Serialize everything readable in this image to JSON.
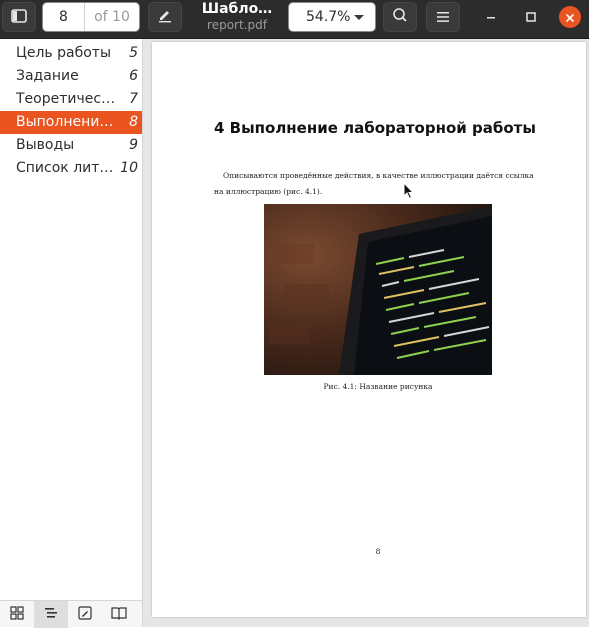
{
  "header": {
    "page_current": "8",
    "page_total": "of 10",
    "title": "Шабло…",
    "subtitle": "report.pdf",
    "zoom": "54.7%",
    "icons": {
      "sidebar_toggle": "sidebar-toggle-icon",
      "annotate": "pencil-icon",
      "search": "search-icon",
      "menu": "hamburger-menu-icon",
      "minimize": "minimize-icon",
      "maximize": "maximize-icon",
      "close": "close-icon"
    }
  },
  "sidebar": {
    "items": [
      {
        "label": "Цель работы",
        "page": "5",
        "active": false
      },
      {
        "label": "Задание",
        "page": "6",
        "active": false
      },
      {
        "label": "Теоретичес…",
        "page": "7",
        "active": false
      },
      {
        "label": "Выполнени…",
        "page": "8",
        "active": true
      },
      {
        "label": "Выводы",
        "page": "9",
        "active": false
      },
      {
        "label": "Список лит…",
        "page": "10",
        "active": false
      }
    ],
    "tabs": [
      "thumbnails-icon",
      "outline-icon",
      "annotations-icon",
      "bookmarks-icon"
    ]
  },
  "document": {
    "heading": "4 Выполнение лабораторной работы",
    "paragraph_line1": "Описываются проведённые действия, в качестве иллюстрации даётся ссылка",
    "paragraph_line2": "на иллюстрацию (рис. 4.1).",
    "caption": "Рис. 4.1: Название рисунка",
    "page_number": "8"
  },
  "colors": {
    "accent": "#e95420",
    "header_bg": "#2c2c2c",
    "canvas_bg": "#e6e6e6"
  }
}
